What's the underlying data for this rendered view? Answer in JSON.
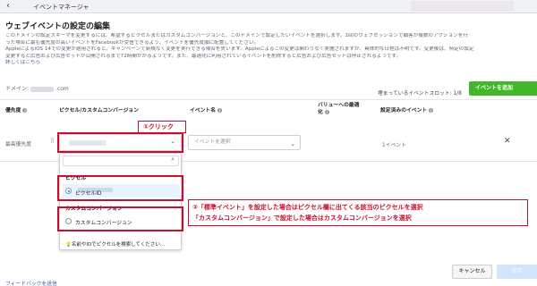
{
  "topbar": {
    "back_icon": "back-arrow-icon",
    "title": "イベントマネージャ"
  },
  "page": {
    "title": "ウェブイベントの設定の編集",
    "description": [
      "このドメインの設定スキーマを変更するには、希望するピクセルまたはカスタムコンバージョンと、このドメインで設定したいイベントを選択します。1回のウェブセッションで顧客が複数のアクションを行",
      "った場合に最も優先度の高いイベントをFacebookが受信できるよう、イベントを優先度順に配置してください。",
      "AppleによるiOS 14での変更が適用されると、キャンペーンで新規なく変更を実行できる場合を失います。Appleによるこの変更は関わりなく実施されますが、具体的な日程は不明です。変更後は、特定の設定",
      "変更すると広告および広告セットが公開されるまで72時間かかるようです。また、最適化に利用されているイベントを削除すると広告および広告セットは停止されるようです。"
    ],
    "more_link": "詳しくはこちら",
    "domain_prefix": "ドメイン:",
    "domain_suffix": ".com",
    "slots_text": "埋まっているイベントスロット: 1/8",
    "add_event_button": "イベントを追加"
  },
  "table": {
    "headers": {
      "priority": "優先度",
      "pixel": "ピクセル/カスタムコンバージョン",
      "event_name": "イベント名",
      "value_opt_line1": "バリューへの最適",
      "value_opt_line2": "化",
      "configured_events": "設定済みのイベント"
    },
    "row": {
      "priority": "最高優先度",
      "event_placeholder": "イベントを選択",
      "configured_count": "1イベント"
    }
  },
  "dropdown": {
    "section_pixel": "ピクセル",
    "pixel_option": "ピクセルID",
    "section_custom": "カスタムコンバージョン",
    "custom_option": "カスタムコンバージョン",
    "footer_hint": "名前やIDでピクセルを検索してください..."
  },
  "annotations": {
    "step1": "①クリック",
    "step2_line1": "②「標準イベント」を設定した場合はピクセル欄に出てくる該当のピクセルを選択",
    "step2_line2": "「カスタムコンバージョン」で設定した場合はカスタムコンバージョンを選択"
  },
  "footer": {
    "feedback_link": "フィードバックを送信",
    "cancel_button": "キャンセル",
    "confirm_button": "保存"
  },
  "colors": {
    "accent_green": "#42b72a",
    "annotation_red": "#c8102e",
    "link_blue": "#385898",
    "selected_bg": "#e7f3ff"
  }
}
